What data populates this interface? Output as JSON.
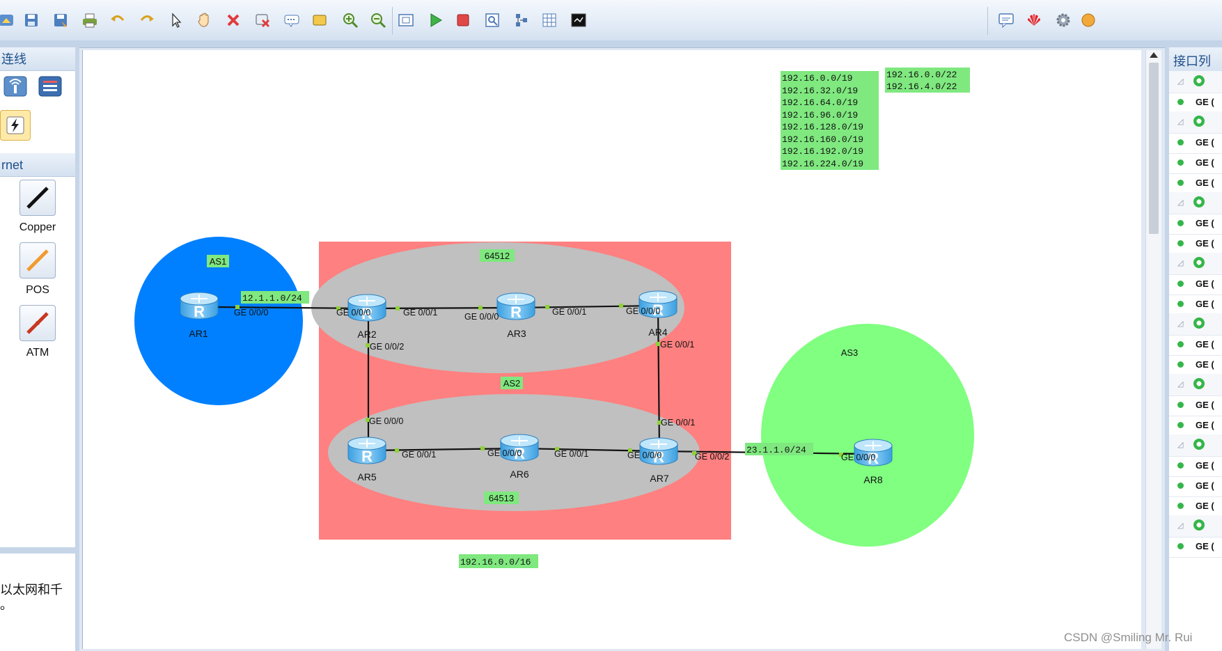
{
  "toolbar": {
    "buttons": [
      "home-icon",
      "save-icon",
      "save-as-icon",
      "print-icon",
      "undo-icon",
      "redo-icon",
      "select-icon",
      "hand-pan-icon",
      "delete-icon",
      "delete-link-icon",
      "text-icon",
      "rectangle-icon",
      "zoom-in-icon",
      "zoom-out-icon",
      "fit-icon",
      "start-icon",
      "stop-icon",
      "capture-icon",
      "topology-icon",
      "grid-icon",
      "console-icon"
    ],
    "right_buttons": [
      "chat-icon",
      "huawei-icon",
      "settings-icon",
      "help-icon"
    ]
  },
  "left_panel": {
    "header_top": "连线",
    "header_mid": "rnet",
    "cables": [
      "Copper",
      "POS",
      "ATM"
    ],
    "desc_line1": "以太网和千",
    "desc_line2": "。"
  },
  "right_panel": {
    "header": "接口列",
    "row_label": "GE ("
  },
  "topology": {
    "devices": [
      "AR1",
      "AR2",
      "AR3",
      "AR4",
      "AR5",
      "AR6",
      "AR7",
      "AR8"
    ],
    "as_labels": {
      "as1": "AS1",
      "as2": "AS2",
      "as3": "AS3",
      "area_a": "64512",
      "area_b": "64513"
    },
    "net_labels": {
      "ar1_ar2": "12.1.1.0/24",
      "ar7_ar8": "23.1.1.0/24",
      "aggregate": "192.16.0.0/16"
    },
    "ports": {
      "ar1_p": "GE 0/0/0",
      "ar2_p0": "GE 0/0/0",
      "ar2_p1": "GE 0/0/1",
      "ar2_p2": "GE 0/0/2",
      "ar3_p0": "GE 0/0/0",
      "ar3_p1": "GE 0/0/1",
      "ar4_p0": "GE 0/0/0",
      "ar4_p1": "GE 0/0/1",
      "ar5_p0": "GE 0/0/0",
      "ar5_p1": "GE 0/0/1",
      "ar6_p0": "GE 0/0/0",
      "ar6_p1": "GE 0/0/1",
      "ar7_p0": "GE 0/0/0",
      "ar7_p1": "GE 0/0/1",
      "ar7_p2": "GE 0/0/2",
      "ar8_p": "GE 0/0/0"
    },
    "routes_a": [
      "192.16.0.0/19",
      "192.16.32.0/19",
      "192.16.64.0/19",
      "192.16.96.0/19",
      "192.16.128.0/19",
      "192.16.160.0/19",
      "192.16.192.0/19",
      "192.16.224.0/19"
    ],
    "routes_b": [
      "192.16.0.0/22",
      "192.16.4.0/22"
    ]
  },
  "watermark": "CSDN @Smiling Mr. Rui",
  "colors": {
    "as1": "#0080ff",
    "as2": "#ff8080",
    "as3": "#80ff80",
    "ellipse": "#c0c0c0",
    "label": "#7fe87f"
  }
}
